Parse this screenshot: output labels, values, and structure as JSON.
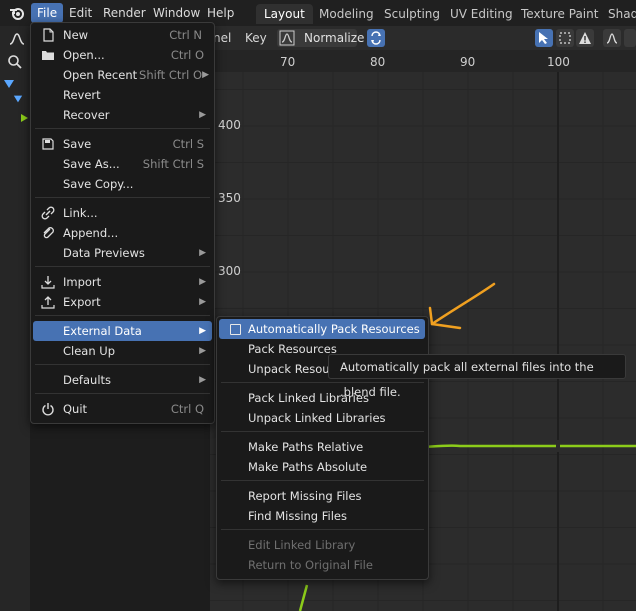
{
  "topbar": {
    "menus": [
      "File",
      "Edit",
      "Render",
      "Window",
      "Help"
    ],
    "workspaces": [
      "Layout",
      "Modeling",
      "Sculpting",
      "UV Editing",
      "Texture Paint",
      "Shadi"
    ]
  },
  "editor_header": {
    "channel_partial": "nel",
    "key": "Key",
    "normalize": "Normalize"
  },
  "graph": {
    "x_ticks": [
      "70",
      "80",
      "90",
      "100"
    ],
    "y_ticks": [
      "400",
      "350",
      "300"
    ],
    "curve_color": "#8ccc1a"
  },
  "file_menu": {
    "items": [
      {
        "label": "New",
        "shortcut": "Ctrl N",
        "icon": "new-file-icon",
        "arrow": true
      },
      {
        "label": "Open...",
        "shortcut": "Ctrl O",
        "icon": "folder-icon"
      },
      {
        "label": "Open Recent",
        "shortcut": "Shift Ctrl O",
        "arrow": true
      },
      {
        "label": "Revert"
      },
      {
        "label": "Recover",
        "arrow": true
      },
      {
        "label": "Save",
        "shortcut": "Ctrl S",
        "icon": "save-icon"
      },
      {
        "label": "Save As...",
        "shortcut": "Shift Ctrl S"
      },
      {
        "label": "Save Copy..."
      },
      {
        "label": "Link...",
        "icon": "link-icon"
      },
      {
        "label": "Append...",
        "icon": "append-icon"
      },
      {
        "label": "Data Previews",
        "arrow": true
      },
      {
        "label": "Import",
        "icon": "import-icon",
        "arrow": true
      },
      {
        "label": "Export",
        "icon": "export-icon",
        "arrow": true
      },
      {
        "label": "External Data",
        "arrow": true
      },
      {
        "label": "Clean Up",
        "arrow": true
      },
      {
        "label": "Defaults",
        "arrow": true
      },
      {
        "label": "Quit",
        "shortcut": "Ctrl Q",
        "icon": "power-icon"
      }
    ]
  },
  "external_data_menu": {
    "items": [
      {
        "label": "Automatically Pack Resources",
        "checkbox": true
      },
      {
        "label": "Pack Resources"
      },
      {
        "label": "Unpack Resources"
      },
      {
        "label": "Pack Linked Libraries"
      },
      {
        "label": "Unpack Linked Libraries"
      },
      {
        "label": "Make Paths Relative"
      },
      {
        "label": "Make Paths Absolute"
      },
      {
        "label": "Report Missing Files"
      },
      {
        "label": "Find Missing Files"
      },
      {
        "label": "Edit Linked Library",
        "disabled": true
      },
      {
        "label": "Return to Original File",
        "disabled": true
      }
    ]
  },
  "tooltip": "Automatically pack all external files into the .blend file.",
  "annotation_color": "#f0a020"
}
